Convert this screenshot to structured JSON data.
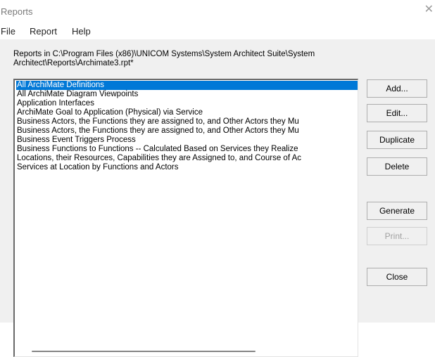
{
  "window": {
    "title": "Reports",
    "close_glyph": "✕"
  },
  "menu": [
    {
      "label": "File"
    },
    {
      "label": "Report"
    },
    {
      "label": "Help"
    }
  ],
  "path_label": "Reports in C:\\Program Files (x86)\\UNICOM Systems\\System Architect Suite\\System Architect\\Reports\\Archimate3.rpt*",
  "reports": [
    {
      "label": "All ArchiMate Definitions",
      "selected": true
    },
    {
      "label": "All ArchiMate Diagram Viewpoints",
      "selected": false
    },
    {
      "label": "Application Interfaces",
      "selected": false
    },
    {
      "label": "ArchiMate Goal to Application (Physical) via Service",
      "selected": false
    },
    {
      "label": "Business Actors, the Functions they are assigned to, and Other Actors they Mu",
      "selected": false
    },
    {
      "label": "Business Actors, the Functions they are assigned to, and Other Actors they Mu",
      "selected": false
    },
    {
      "label": "Business Event Triggers Process",
      "selected": false
    },
    {
      "label": "Business Functions to Functions -- Calculated Based on Services they Realize",
      "selected": false
    },
    {
      "label": "Locations, their Resources, Capabilities they are Assigned to, and Course of Ac",
      "selected": false
    },
    {
      "label": "Services at Location by Functions and Actors",
      "selected": false
    }
  ],
  "buttons": {
    "add": {
      "label": "Add...",
      "enabled": true
    },
    "edit": {
      "label": "Edit...",
      "enabled": true
    },
    "duplicate": {
      "label": "Duplicate",
      "enabled": true
    },
    "delete": {
      "label": "Delete",
      "enabled": true
    },
    "generate": {
      "label": "Generate",
      "enabled": true
    },
    "print": {
      "label": "Print...",
      "enabled": false
    },
    "close": {
      "label": "Close",
      "enabled": true
    }
  },
  "colors": {
    "selection": "#0078d7",
    "dialog_bg": "#f0f0f0"
  }
}
